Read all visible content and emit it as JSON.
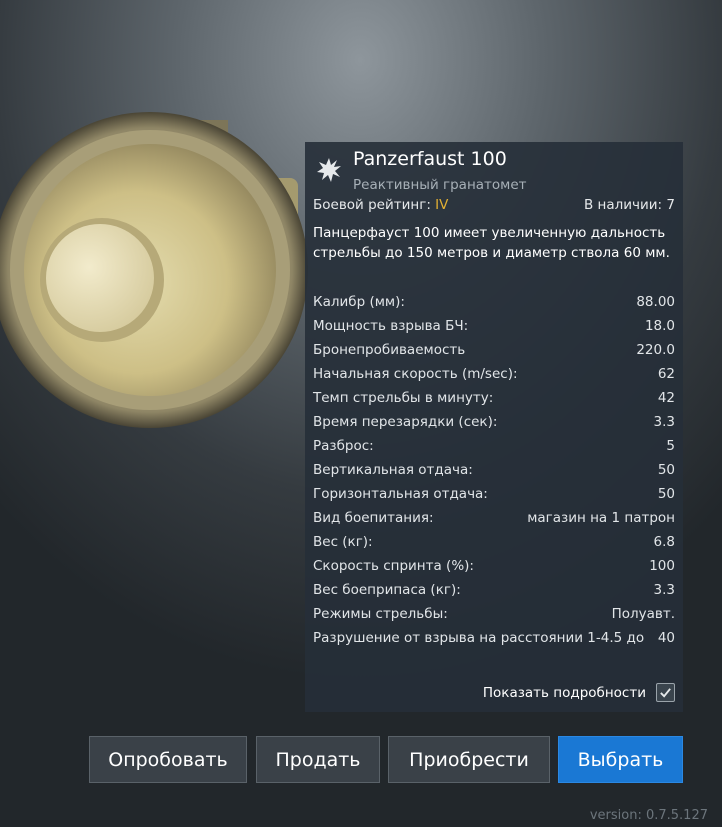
{
  "weapon": {
    "name": "Panzerfaust 100",
    "type": "Реактивный гранатомет",
    "icon": "explosion-icon",
    "rating_label": "Боевой рейтинг:",
    "rating_value": "IV",
    "stock": "В наличии: 7",
    "description": "Панцерфауст 100 имеет увеличенную дальность стрельбы до 150 метров и диаметр ствола 60 мм."
  },
  "stats": [
    {
      "label": "Калибр (мм):",
      "value": "88.00"
    },
    {
      "label": "Мощность взрыва БЧ:",
      "value": "18.0"
    },
    {
      "label": "Бронепробиваемость",
      "value": "220.0"
    },
    {
      "label": "Начальная скорость (m/sec):",
      "value": "62"
    },
    {
      "label": "Темп стрельбы в минуту:",
      "value": "42"
    },
    {
      "label": "Время перезарядки (сек):",
      "value": "3.3"
    },
    {
      "label": "Разброс:",
      "value": "5"
    },
    {
      "label": "Вертикальная отдача:",
      "value": "50"
    },
    {
      "label": "Горизонтальная отдача:",
      "value": "50"
    },
    {
      "label": "Вид боепитания:",
      "value": "магазин на 1 патрон"
    },
    {
      "label": "Вес (кг):",
      "value": "6.8"
    },
    {
      "label": "Скорость спринта (%):",
      "value": "100"
    },
    {
      "label": "Вес боеприпаса (кг):",
      "value": "3.3"
    },
    {
      "label": "Режимы стрельбы:",
      "value": "Полуавт."
    },
    {
      "label": "Разрушение от взрыва на расстоянии 1-4.5 до",
      "value": "40"
    }
  ],
  "details_toggle": {
    "label": "Показать подробности",
    "checked": true
  },
  "buttons": {
    "try": "Опробовать",
    "sell": "Продать",
    "buy": "Приобрести",
    "select": "Выбрать"
  },
  "version": "version: 0.7.5.127",
  "colors": {
    "accent": "#1a78d4",
    "tier": "#e2b033",
    "panel": "#262f38"
  }
}
